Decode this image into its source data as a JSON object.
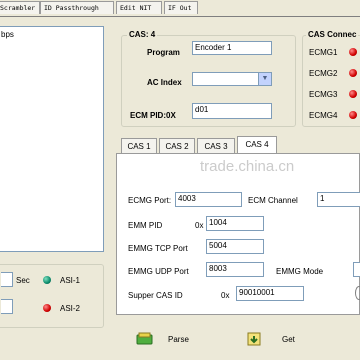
{
  "top_tabs": [
    "Scrambler",
    "ID Passthrough",
    "Edit NIT",
    "IF Out"
  ],
  "left_list": {
    "item": "bps"
  },
  "cas_group": {
    "title": "CAS: 4",
    "program_label": "Program",
    "program_value": "Encoder 1",
    "ac_index_label": "AC Index",
    "ecm_pid_label": "ECM PID:0X",
    "ecm_pid_value": "d01"
  },
  "cas_connect": {
    "title": "CAS Connec",
    "ecmgs": [
      {
        "label": "ECMG1",
        "status_color": "#d00000"
      },
      {
        "label": "ECMG2",
        "status_color": "#d00000"
      },
      {
        "label": "ECMG3",
        "status_color": "#d00000"
      },
      {
        "label": "ECMG4",
        "status_color": "#d00000"
      }
    ]
  },
  "cas_tabs": [
    "CAS 1",
    "CAS 2",
    "CAS 3",
    "CAS 4"
  ],
  "active_cas_tab": "CAS 4",
  "cas_panel": {
    "ecmg_port_label": "ECMG Port:",
    "ecmg_port_value": "4003",
    "ecm_channel_label": "ECM Channel",
    "ecm_channel_value": "1",
    "emm_pid_label": "EMM PID",
    "emm_pid_prefix": "0x",
    "emm_pid_value": "1004",
    "emmg_tcp_label": "EMMG TCP Port",
    "emmg_tcp_value": "5004",
    "emmg_udp_label": "EMMG UDP Port",
    "emmg_udp_value": "8003",
    "emmg_mode_label": "EMMG Mode",
    "supper_cas_label": "Supper CAS ID",
    "supper_cas_prefix": "0x",
    "supper_cas_value": "90010001"
  },
  "asi": {
    "sec_label": "Sec",
    "asi1_label": "ASI-1",
    "asi1_color": "#0a8a6a",
    "asi2_label": "ASI-2",
    "asi2_color": "#d00000"
  },
  "buttons": {
    "parse": "Parse",
    "get": "Get"
  },
  "watermark": "trade.china.cn"
}
